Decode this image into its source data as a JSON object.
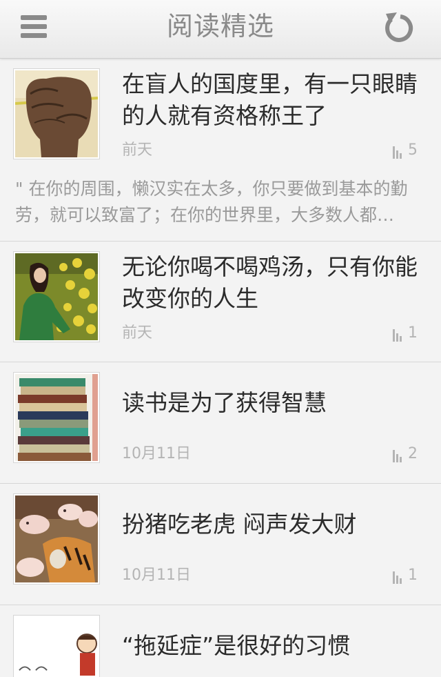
{
  "header": {
    "title": "阅读精选",
    "menu_icon": "hamburger-icon",
    "refresh_icon": "refresh-icon"
  },
  "articles": [
    {
      "title": "在盲人的国度里，有一只眼睛的人就有资格称王了",
      "date": "前天",
      "count": "5",
      "excerpt": "\" 在你的周围，懒汉实在太多，你只要做到基本的勤劳，就可以致富了；在你的世界里，大多数人都…",
      "thumb": "fist-photo"
    },
    {
      "title": "无论你喝不喝鸡汤，只有你能改变你的人生",
      "date": "前天",
      "count": "1",
      "thumb": "woman-in-flower-field-photo"
    },
    {
      "title": "读书是为了获得智慧",
      "date": "10月11日",
      "count": "2",
      "thumb": "book-stack-photo"
    },
    {
      "title": "扮猪吃老虎 闷声发大财",
      "date": "10月11日",
      "count": "1",
      "thumb": "piglets-and-tiger-photo"
    },
    {
      "title": "“拖延症”是很好的习惯",
      "thumb": "cartoon-man-photo"
    }
  ]
}
